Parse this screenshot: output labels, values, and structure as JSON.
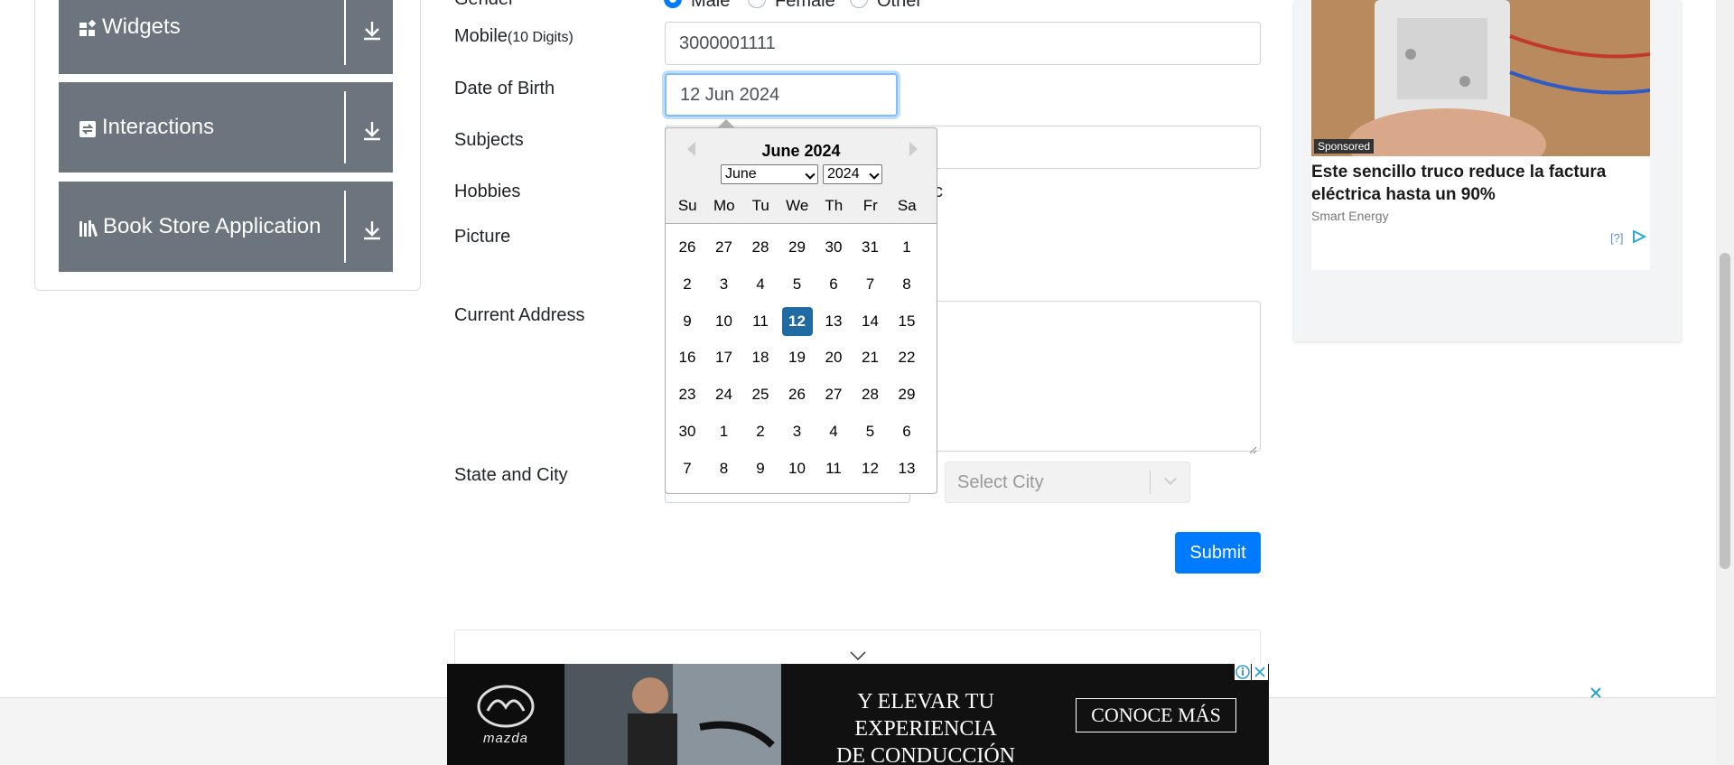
{
  "sidebar": {
    "groups": [
      {
        "label": "Widgets",
        "icon": "widgets-icon"
      },
      {
        "label": "Interactions",
        "icon": "interactions-icon"
      },
      {
        "label": "Book Store Application",
        "icon": "book-store-icon"
      }
    ]
  },
  "form": {
    "gender_label": "Gender",
    "gender_options": [
      "Male",
      "Female",
      "Other"
    ],
    "gender_selected": "Male",
    "mobile_label": "Mobile",
    "mobile_hint": "(10 Digits)",
    "mobile_value": "3000001111",
    "dob_label": "Date of Birth",
    "dob_value": "12 Jun 2024",
    "subjects_label": "Subjects",
    "hobbies_label": "Hobbies",
    "hobbies_partial_text": "c",
    "picture_label": "Picture",
    "address_label": "Current Address",
    "state_city_label": "State and City",
    "city_placeholder": "Select City",
    "submit_label": "Submit"
  },
  "datepicker": {
    "title": "June 2024",
    "month_select": "June",
    "year_select": "2024",
    "weekdays": [
      "Su",
      "Mo",
      "Tu",
      "We",
      "Th",
      "Fr",
      "Sa"
    ],
    "weeks": [
      [
        "26",
        "27",
        "28",
        "29",
        "30",
        "31",
        "1"
      ],
      [
        "2",
        "3",
        "4",
        "5",
        "6",
        "7",
        "8"
      ],
      [
        "9",
        "10",
        "11",
        "12",
        "13",
        "14",
        "15"
      ],
      [
        "16",
        "17",
        "18",
        "19",
        "20",
        "21",
        "22"
      ],
      [
        "23",
        "24",
        "25",
        "26",
        "27",
        "28",
        "29"
      ],
      [
        "30",
        "1",
        "2",
        "3",
        "4",
        "5",
        "6"
      ],
      [
        "7",
        "8",
        "9",
        "10",
        "11",
        "12",
        "13"
      ]
    ],
    "selected_day": "12"
  },
  "right_ad": {
    "badge": "Sponsored",
    "headline": "Este sencillo truco reduce la factura eléctrica hasta un 90%",
    "source": "Smart Energy",
    "help": "[?]"
  },
  "banner_ad": {
    "brand": "mazda",
    "text_line1": "Y ELEVAR TU EXPERIENCIA",
    "text_line2": "DE CONDUCCIÓN",
    "cta": "CONOCE MÁS"
  },
  "colors": {
    "primary": "#007bff",
    "sidebar_header": "#6c757d",
    "selected_day": "#216ba5"
  }
}
